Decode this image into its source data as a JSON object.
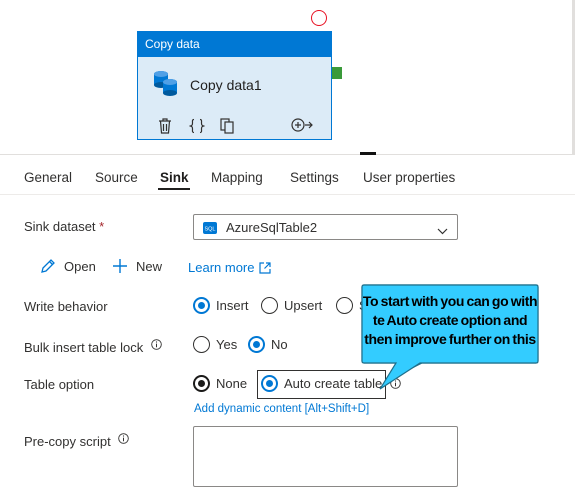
{
  "node": {
    "header": "Copy data",
    "title": "Copy data1"
  },
  "tabs": [
    {
      "label": "General",
      "active": false
    },
    {
      "label": "Source",
      "active": false
    },
    {
      "label": "Sink",
      "active": true
    },
    {
      "label": "Mapping",
      "active": false
    },
    {
      "label": "Settings",
      "active": false
    },
    {
      "label": "User properties",
      "active": false
    }
  ],
  "sink": {
    "dataset_label": "Sink dataset",
    "required_mark": "*",
    "dataset_value": "AzureSqlTable2",
    "dataset_icon_text": "SQL",
    "open_label": "Open",
    "new_label": "New",
    "learn_more_label": "Learn more",
    "write_behavior_label": "Write behavior",
    "write_behavior_options": [
      "Insert",
      "Upsert",
      "S"
    ],
    "write_behavior_selected": "Insert",
    "bulk_lock_label": "Bulk insert table lock",
    "bulk_lock_options": [
      "Yes",
      "No"
    ],
    "bulk_lock_selected": "No",
    "table_option_label": "Table option",
    "table_option_options": [
      "None",
      "Auto create table"
    ],
    "table_option_selected": "Auto create table",
    "dynamic_content_link": "Add dynamic content [Alt+Shift+D]",
    "precopy_label": "Pre-copy script",
    "precopy_value": ""
  },
  "callout": {
    "text": "To start with you can go with te Auto create option and then improve further on this"
  },
  "colors": {
    "accent": "#0078d4",
    "callout_fill": "#33ccff",
    "status_ring": "#e81123",
    "port": "#3a9a3a"
  }
}
